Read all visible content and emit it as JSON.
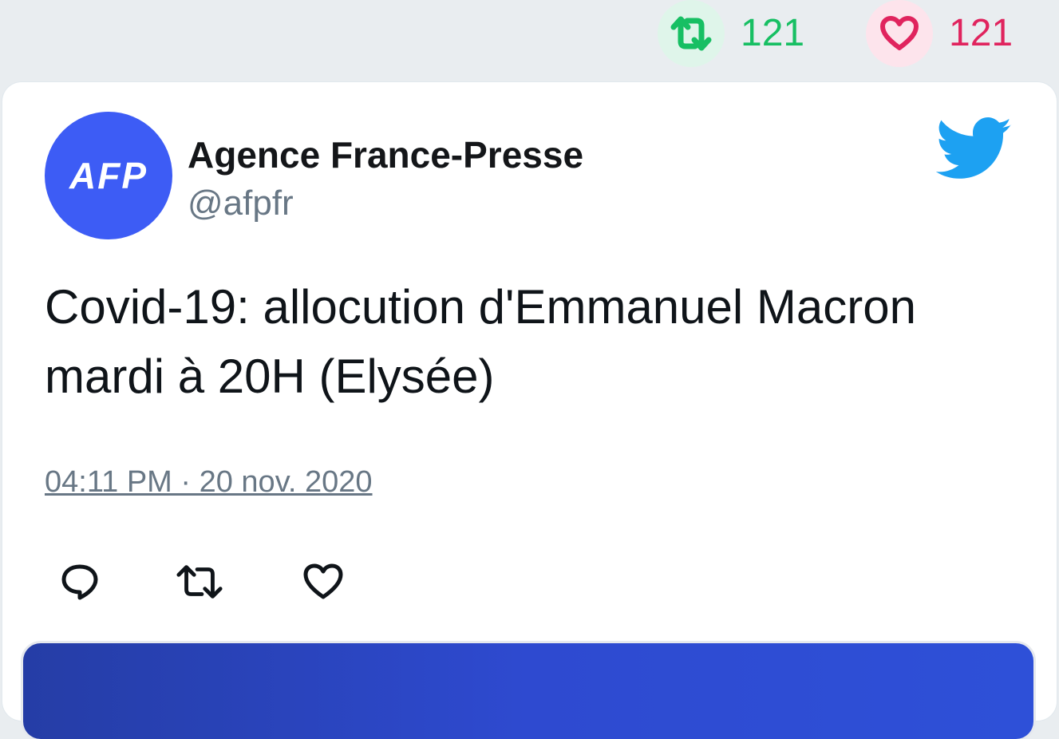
{
  "stats": {
    "retweet_count": "121",
    "like_count": "121"
  },
  "tweet": {
    "author_name": "Agence France-Presse",
    "author_handle": "@afpfr",
    "avatar_text": "AFP",
    "text_line1": "Covid-19: allocution d'Emmanuel Macron",
    "text_line2": "mardi à 20H (Elysée)",
    "timestamp": "04:11 PM · 20 nov. 2020"
  },
  "icons": {
    "retweet_stat": "retweet-icon",
    "like_stat": "heart-icon",
    "brand": "twitter-bird-icon",
    "reply": "reply-icon",
    "retweet": "retweet-icon",
    "like": "heart-icon"
  },
  "colors": {
    "retweet_green": "#17bf63",
    "like_red": "#e0245e",
    "twitter_blue": "#1da1f2",
    "avatar_blue": "#3d5cf5",
    "media_blue": "#2e4ad0",
    "background": "#e9edf0",
    "muted_text": "#687785"
  }
}
